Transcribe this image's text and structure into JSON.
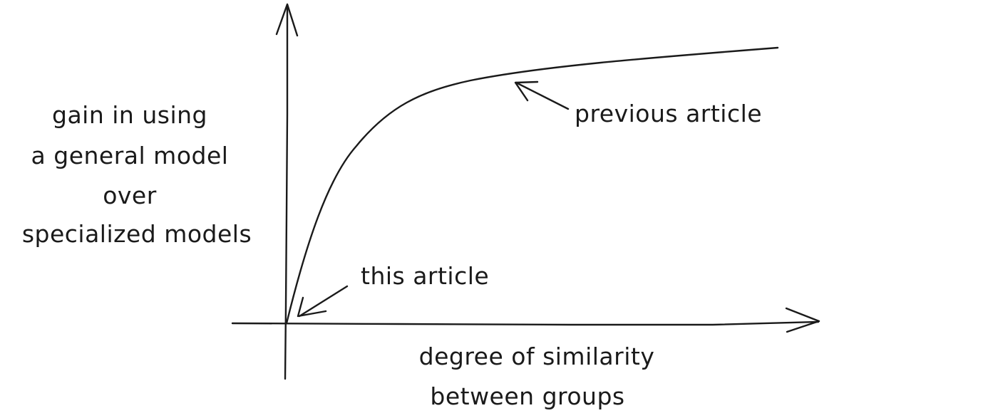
{
  "diagram": {
    "y_axis_label_lines": [
      "gain in using",
      "a general model",
      "over",
      "specialized models"
    ],
    "x_axis_label_lines": [
      "degree of similarity",
      "between groups"
    ],
    "annotations": {
      "previous": "previous article",
      "this": "this article"
    },
    "ink_color": "#1a1a1a"
  }
}
